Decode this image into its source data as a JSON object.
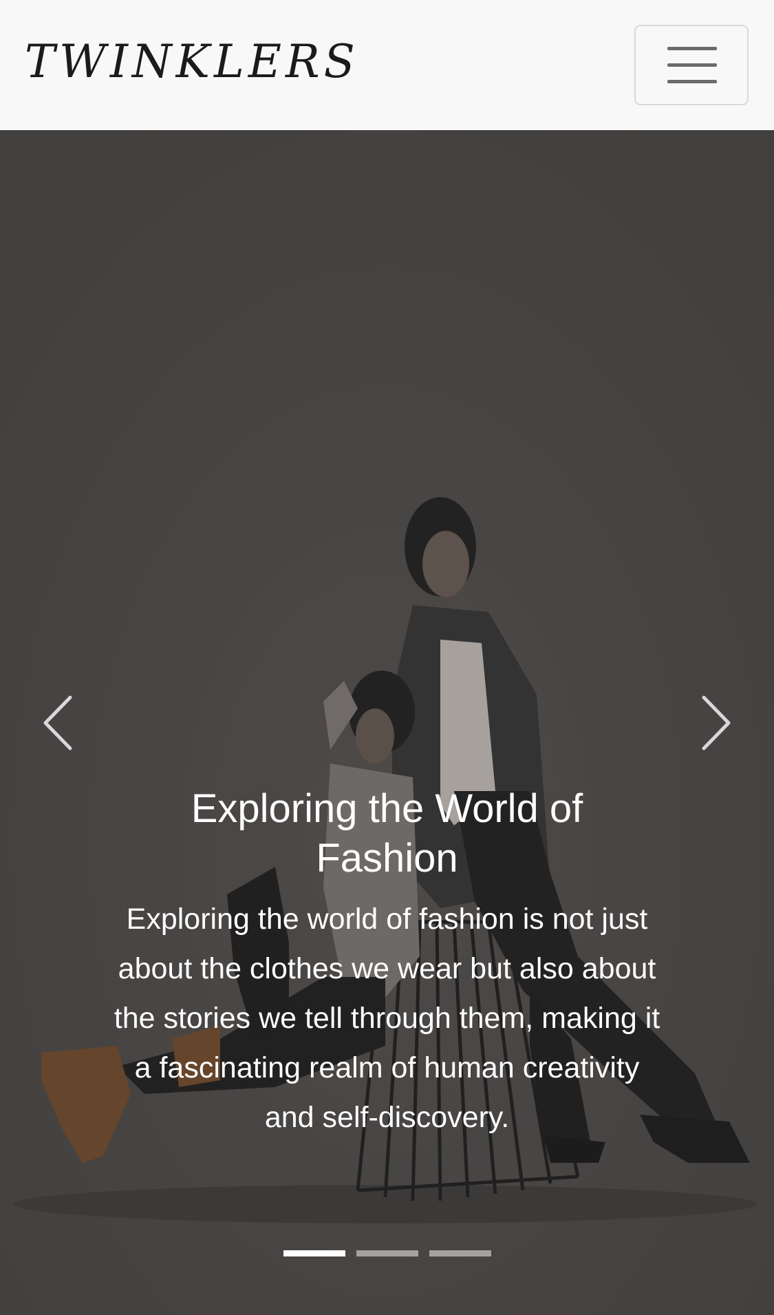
{
  "navbar": {
    "brand": "TWINKLERS",
    "toggler_icon": "hamburger-icon"
  },
  "carousel": {
    "slide": {
      "title": "Exploring the World of Fashion",
      "text": "Exploring the world of fashion is not just about the clothes we wear but also about the stories we tell through them, making it a fascinating realm of human creativity and self-discovery."
    },
    "prev_icon": "chevron-left-icon",
    "next_icon": "chevron-right-icon",
    "indicator_count": 3,
    "active_index": 0
  },
  "colors": {
    "navbar_bg": "#f8f8f8",
    "overlay": "#4a4846",
    "caption_text": "#ffffff"
  }
}
